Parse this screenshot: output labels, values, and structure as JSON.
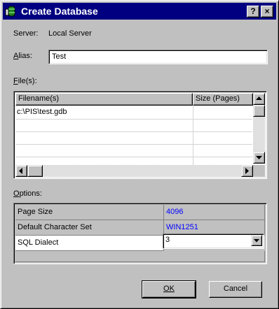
{
  "window": {
    "title": "Create Database",
    "help_label": "?",
    "close_label": "×"
  },
  "server": {
    "label": "Server:",
    "value": "Local Server"
  },
  "alias": {
    "label": "Alias:",
    "value": "Test"
  },
  "files": {
    "label": "File(s):",
    "columns": [
      "Filename(s)",
      "Size (Pages)"
    ],
    "rows": [
      {
        "filename": "c:\\PIS\\test.gdb",
        "size": ""
      }
    ]
  },
  "options": {
    "label": "Options:",
    "rows": [
      {
        "name": "Page Size",
        "value": "4096"
      },
      {
        "name": "Default Character Set",
        "value": "WIN1251"
      },
      {
        "name": "SQL Dialect",
        "value": "3"
      }
    ],
    "value_color": "#0000ff"
  },
  "buttons": {
    "ok": "OK",
    "cancel": "Cancel"
  },
  "colors": {
    "titlebar": "#000080",
    "face": "#c0c0c0"
  }
}
